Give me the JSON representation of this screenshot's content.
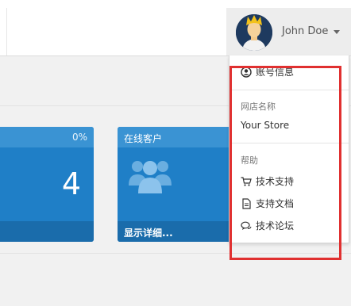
{
  "header": {
    "user_name": "John Doe"
  },
  "tiles": [
    {
      "percent": "0%",
      "value": "4"
    },
    {
      "title": "在线客户",
      "footer_link": "显示详细..."
    }
  ],
  "dropdown": {
    "account_label": "账号信息",
    "store_header": "网店名称",
    "store_name": "Your Store",
    "help_header": "帮助",
    "help_items": [
      {
        "icon": "cart-icon",
        "label": "技术支持"
      },
      {
        "icon": "document-icon",
        "label": "支持文档"
      },
      {
        "icon": "chat-icon",
        "label": "技术论坛"
      }
    ]
  },
  "colors": {
    "tile_blue": "#1f7fc7",
    "highlight_red": "#e03030"
  }
}
